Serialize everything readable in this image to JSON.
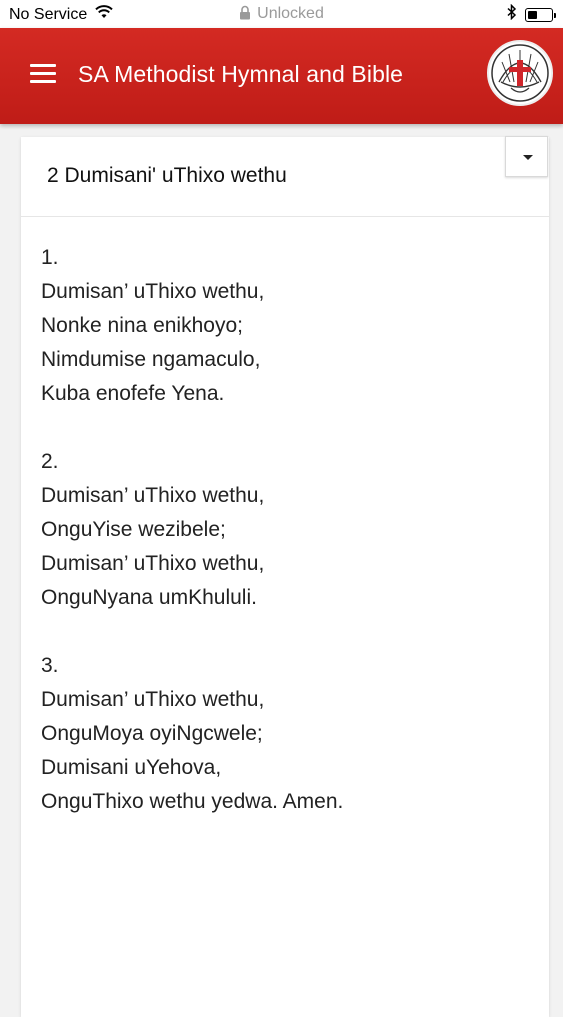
{
  "status_bar": {
    "carrier": "No Service",
    "lock_text": "Unlocked",
    "battery_level": 0.45
  },
  "header": {
    "title": "SA Methodist Hymnal and Bible"
  },
  "hymn": {
    "title": "2 Dumisani' uThixo wethu",
    "verses": [
      {
        "number": "1.",
        "lines": [
          "Dumisan’ uThixo wethu,",
          "Nonke nina enikhoyo;",
          "Nimdumise ngamaculo,",
          "Kuba enofefe Yena."
        ]
      },
      {
        "number": "2.",
        "lines": [
          "Dumisan’ uThixo wethu,",
          "OnguYise wezibele;",
          "Dumisan’ uThixo wethu,",
          "OnguNyana umKhululi."
        ]
      },
      {
        "number": "3.",
        "lines": [
          "Dumisan’ uThixo wethu,",
          "OnguMoya oyiNgcwele;",
          "Dumisani uYehova,",
          "OnguThixo wethu yedwa. Amen."
        ]
      }
    ]
  },
  "colors": {
    "header_red": "#c8221c",
    "logo_cross": "#d0262b"
  }
}
